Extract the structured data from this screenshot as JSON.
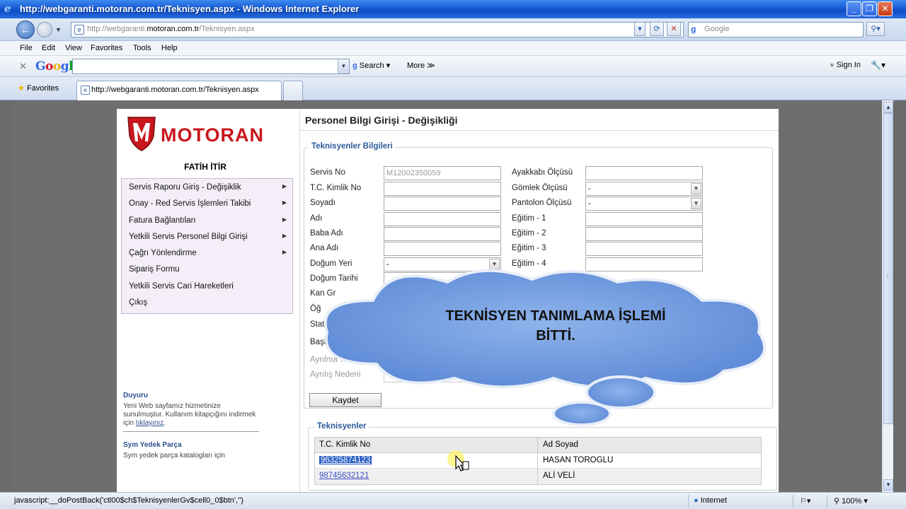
{
  "window": {
    "title": "http://webgaranti.motoran.com.tr/Teknisyen.aspx - Windows Internet Explorer",
    "minimize": "_",
    "restore": "❐",
    "close": "✕"
  },
  "address": {
    "url_prefix": "http://webgaranti.",
    "url_host": "motoran.com.tr",
    "url_path": "/Teknisyen.aspx",
    "search_placeholder": "Google"
  },
  "menu": [
    "File",
    "Edit",
    "View",
    "Favorites",
    "Tools",
    "Help"
  ],
  "google_toolbar": {
    "search_label": "Search",
    "more_label": "More ≫",
    "signin_label": "Sign In"
  },
  "favorites": {
    "label": "Favorites",
    "tab_title": "http://webgaranti.motoran.com.tr/Teknisyen.aspx"
  },
  "site": {
    "logo_text": "MOTORAN",
    "user_name": "FATİH İTİR",
    "menu_items": [
      {
        "label": "Servis Raporu Giriş - Değişiklik",
        "arrow": "▶"
      },
      {
        "label": "Onay - Red Servis İşlemleri Takibi",
        "arrow": "▶"
      },
      {
        "label": "Fatura Bağlantıları",
        "arrow": "▶"
      },
      {
        "label": "Yetkili Servis Personel Bilgi Girişi",
        "arrow": "▶"
      },
      {
        "label": "Çağrı Yönlendirme",
        "arrow": "▶"
      },
      {
        "label": "Sipariş Formu",
        "arrow": ""
      },
      {
        "label": "Yetkili Servis Cari Hareketleri",
        "arrow": ""
      },
      {
        "label": "Çıkış",
        "arrow": ""
      }
    ],
    "duyuru_title": "Duyuru",
    "duyuru_text": "Yeni Web sayfamız hizmetinize sunulmuştur. Kullanım kitapçığını indirmek için ",
    "duyuru_link": "tıklayınız",
    "duyuru_end": ".",
    "sym_title": "Sym Yedek Parça",
    "sym_text": "Sym yedek parça katalogları için"
  },
  "form": {
    "page_title": "Personel Bilgi Girişi - Değişikliği",
    "section_title": "Teknisyenler Bilgileri",
    "left_labels": [
      "Servis No",
      "T.C. Kimlik No",
      "Soyadı",
      "Adı",
      "Baba Adı",
      "Ana Adı",
      "Doğum Yeri",
      "Doğum Tarihi",
      "Kan Gr",
      "Öğ",
      "Stat",
      "Başla"
    ],
    "servis_no_value": "M12002350059",
    "dogum_yeri_value": "-",
    "right_labels": [
      "Ayakkabı Ölçüsü",
      "Gömlek Ölçüsü",
      "Pantolon Ölçüsü",
      "Eğitim - 1",
      "Eğitim - 2",
      "Eğitim - 3",
      "Eğitim - 4"
    ],
    "gomlek_value": "-",
    "pantolon_value": "-",
    "ayrilma_tarihi_label": "Ayrılma Tarihi",
    "ayrilis_nedeni_label": "Ayrılış Nedeni",
    "save_label": "Kaydet"
  },
  "technicians": {
    "title": "Teknisyenler",
    "columns": [
      "T.C. Kimlik No",
      "Ad Soyad"
    ],
    "rows": [
      {
        "tc": "96325874123",
        "name": "HASAN TOROGLU"
      },
      {
        "tc": "98745632121",
        "name": "ALİ VELİ"
      }
    ]
  },
  "callout": {
    "line1": "TEKNİSYEN TANIMLAMA İŞLEMİ",
    "line2": "BİTTİ."
  },
  "status": {
    "text": "javascript:__doPostBack('ctl00$ch$TeknisyenlerGv$cell0_0$btn','')",
    "zone": "Internet",
    "zoom": "100%"
  },
  "colors": {
    "brand_red": "#c8171d",
    "link_blue": "#3b4fc4",
    "callout_fill": "#6f9be0"
  }
}
